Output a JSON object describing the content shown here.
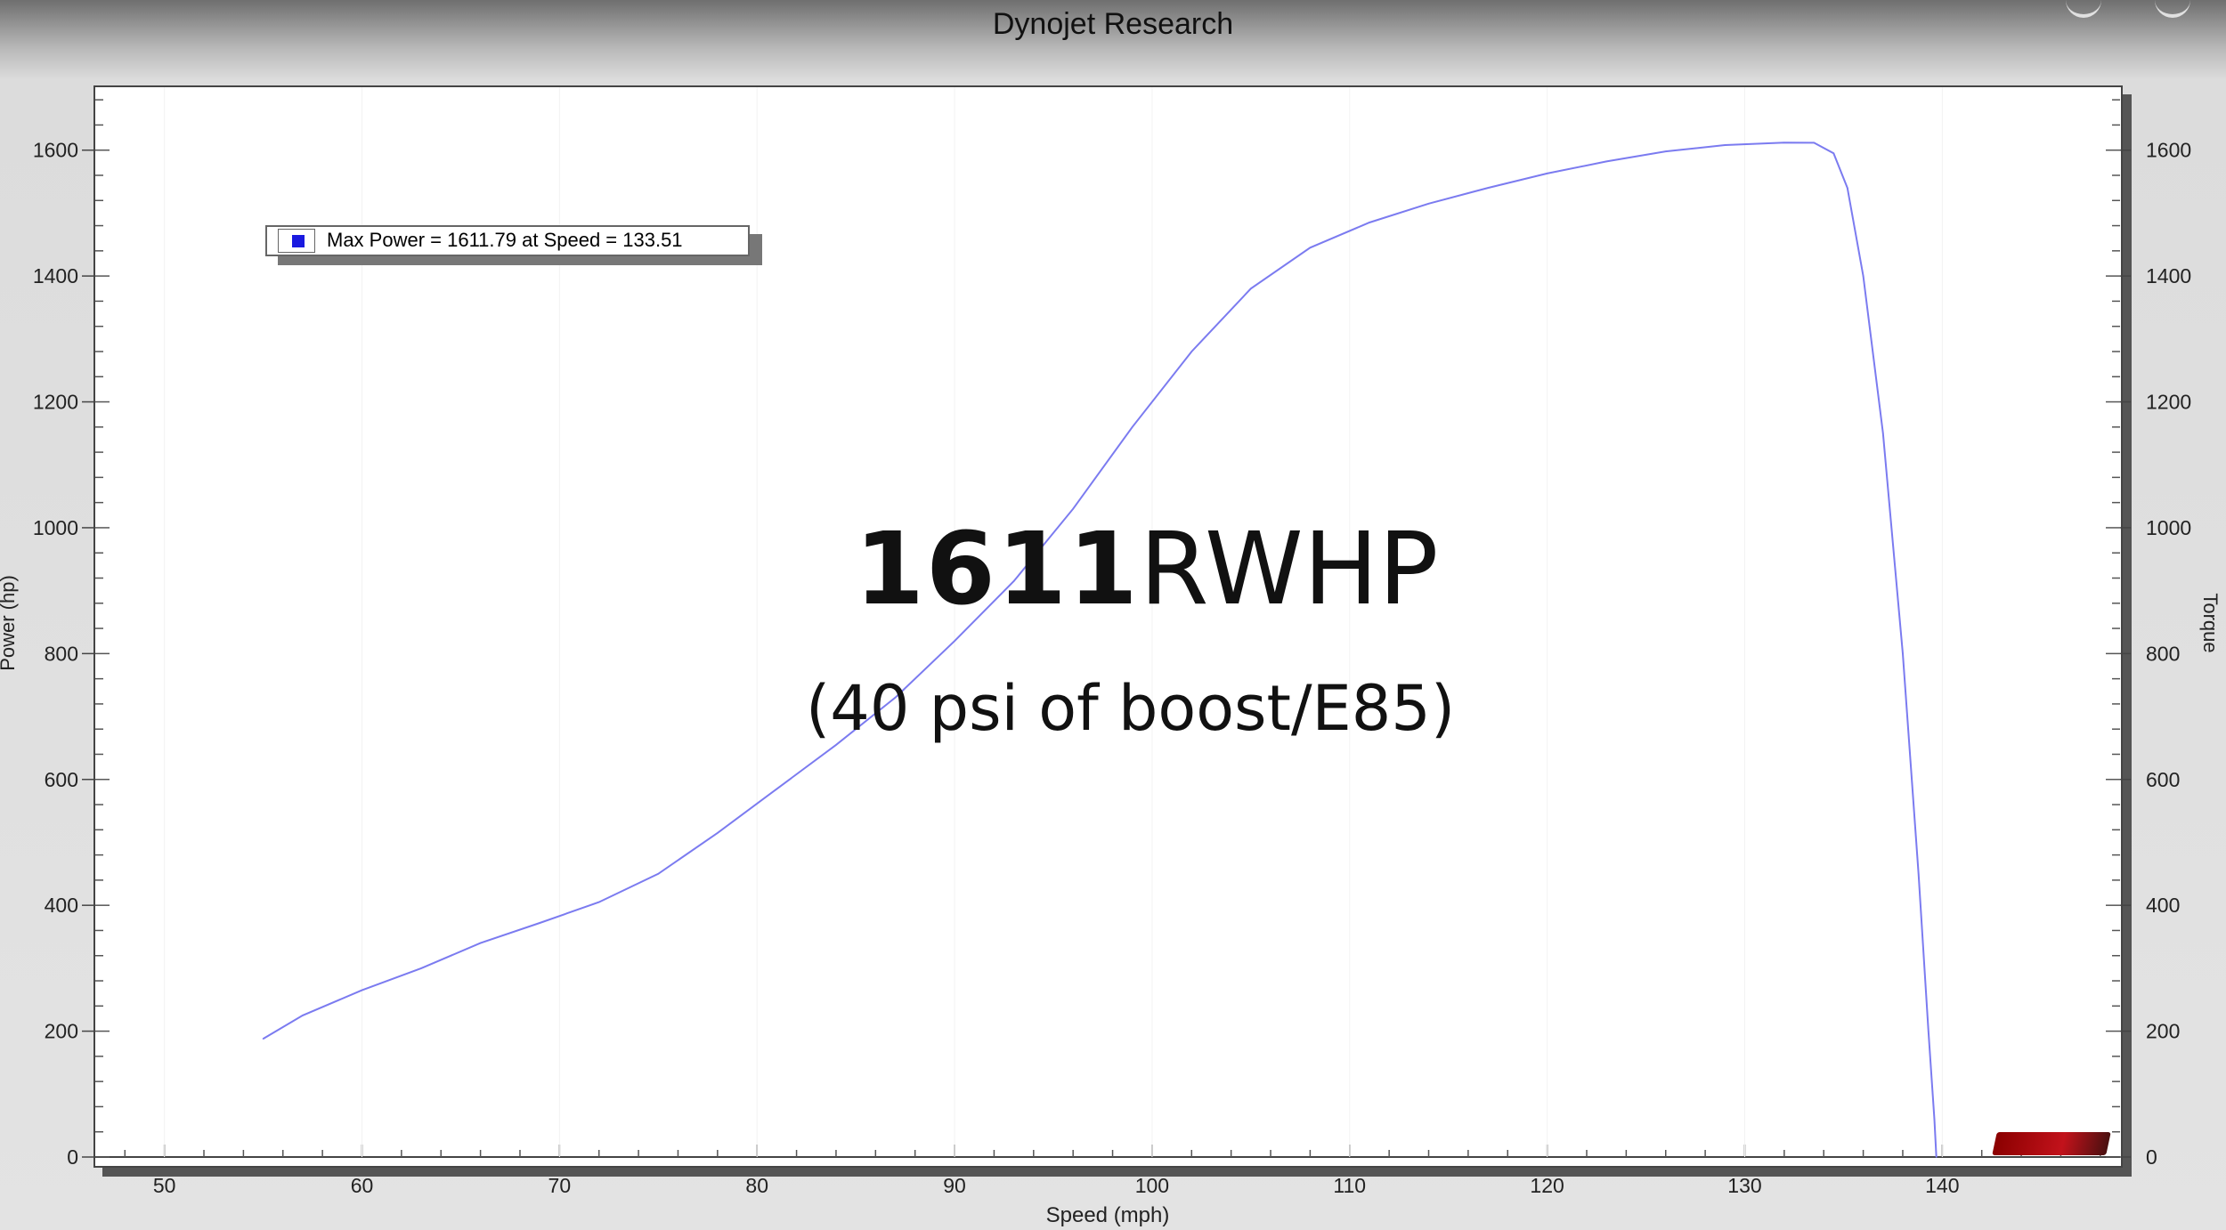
{
  "header": {
    "title": "Dynojet Research"
  },
  "overlay": {
    "power_number": "1611",
    "power_unit": "RWHP",
    "subtitle": "(40 psi of boost/E85)"
  },
  "legend": {
    "text": "Max Power = 1611.79 at Speed = 133.51",
    "marker_color": "#1a1ae0"
  },
  "chart_data": {
    "type": "line",
    "xlabel": "Speed (mph)",
    "ylabel": "Power (hp)",
    "y2label": "Torque",
    "xlim": [
      46.5,
      149
    ],
    "ylim": [
      0,
      1700
    ],
    "x_ticks": [
      50,
      60,
      70,
      80,
      90,
      100,
      110,
      120,
      130,
      140
    ],
    "y_ticks": [
      0,
      200,
      400,
      600,
      800,
      1000,
      1200,
      1400,
      1600
    ],
    "y2_ticks": [
      0,
      200,
      400,
      600,
      800,
      1000,
      1200,
      1400,
      1600
    ],
    "grid": false,
    "series": [
      {
        "color": "#7b7bf0",
        "x": [
          55.0,
          57.0,
          60.0,
          63.0,
          66.0,
          69.0,
          72.0,
          75.0,
          78.0,
          81.0,
          84.0,
          87.0,
          90.0,
          93.0,
          96.0,
          99.0,
          102.0,
          105.0,
          108.0,
          111.0,
          114.0,
          117.0,
          120.0,
          123.0,
          126.0,
          129.0,
          132.0,
          133.51,
          134.5,
          135.2,
          136.0,
          137.0,
          138.0,
          138.8,
          139.3,
          139.6,
          139.7
        ],
        "y": [
          188,
          225,
          265,
          300,
          340,
          372,
          405,
          450,
          515,
          585,
          655,
          730,
          820,
          915,
          1030,
          1160,
          1280,
          1380,
          1445,
          1485,
          1515,
          1540,
          1563,
          1582,
          1598,
          1608,
          1612,
          1611.79,
          1595,
          1540,
          1400,
          1150,
          800,
          450,
          200,
          60,
          0
        ]
      }
    ]
  }
}
